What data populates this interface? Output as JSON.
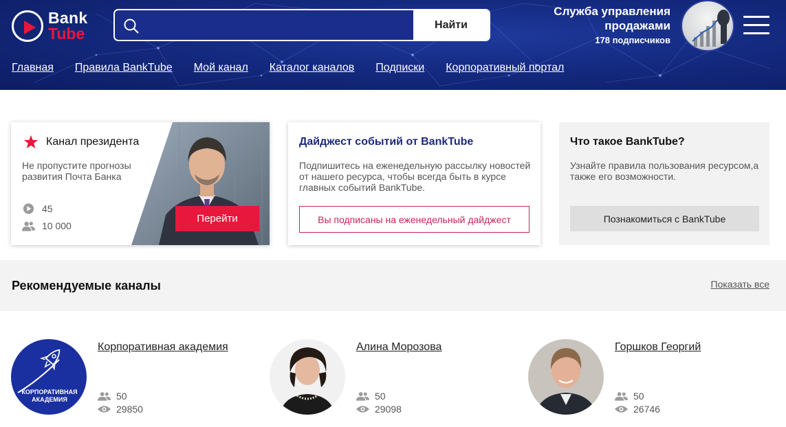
{
  "brand": {
    "line1": "Bank",
    "line2": "Tube"
  },
  "search": {
    "placeholder": "",
    "button": "Найти"
  },
  "channel": {
    "name": "Служба управления продажами",
    "subscribers": "178 подписчиков"
  },
  "nav": [
    {
      "label": "Главная"
    },
    {
      "label": "Правила BankTube"
    },
    {
      "label": "Мой канал"
    },
    {
      "label": "Каталог каналов"
    },
    {
      "label": "Подписки"
    },
    {
      "label": "Корпоративный портал"
    }
  ],
  "president_card": {
    "title": "Канал президента",
    "description": "Не пропустите прогнозы развития Почта Банка",
    "videos": "45",
    "subscribers": "10 000",
    "button": "Перейти"
  },
  "digest_card": {
    "title": "Дайджест событий от BankTube",
    "description": "Подпишитесь на еженедельную рассылку новостей от нашего ресурса, чтобы всегда быть в курсе главных событий BankTube.",
    "button": "Вы подписаны на еженедельный дайджест"
  },
  "what_card": {
    "title": "Что такое BankTube?",
    "description": "Узнайте правила пользования ресурсом,а также его возможности.",
    "button": "Познакомиться с BankTube"
  },
  "recommended": {
    "title": "Рекомендуемые каналы",
    "show_all": "Показать все",
    "channels": [
      {
        "name": "Корпоративная академия",
        "subscribers": "50",
        "views": "29850",
        "logo_text": "КОРПОРАТИВНАЯ АКАДЕМИЯ"
      },
      {
        "name": "Алина Морозова",
        "subscribers": "50",
        "views": "29098"
      },
      {
        "name": "Горшков Георгий",
        "subscribers": "50",
        "views": "26746"
      }
    ]
  },
  "colors": {
    "header": "#142a80",
    "accent": "#e8173c",
    "digest_border": "#c4255a"
  }
}
